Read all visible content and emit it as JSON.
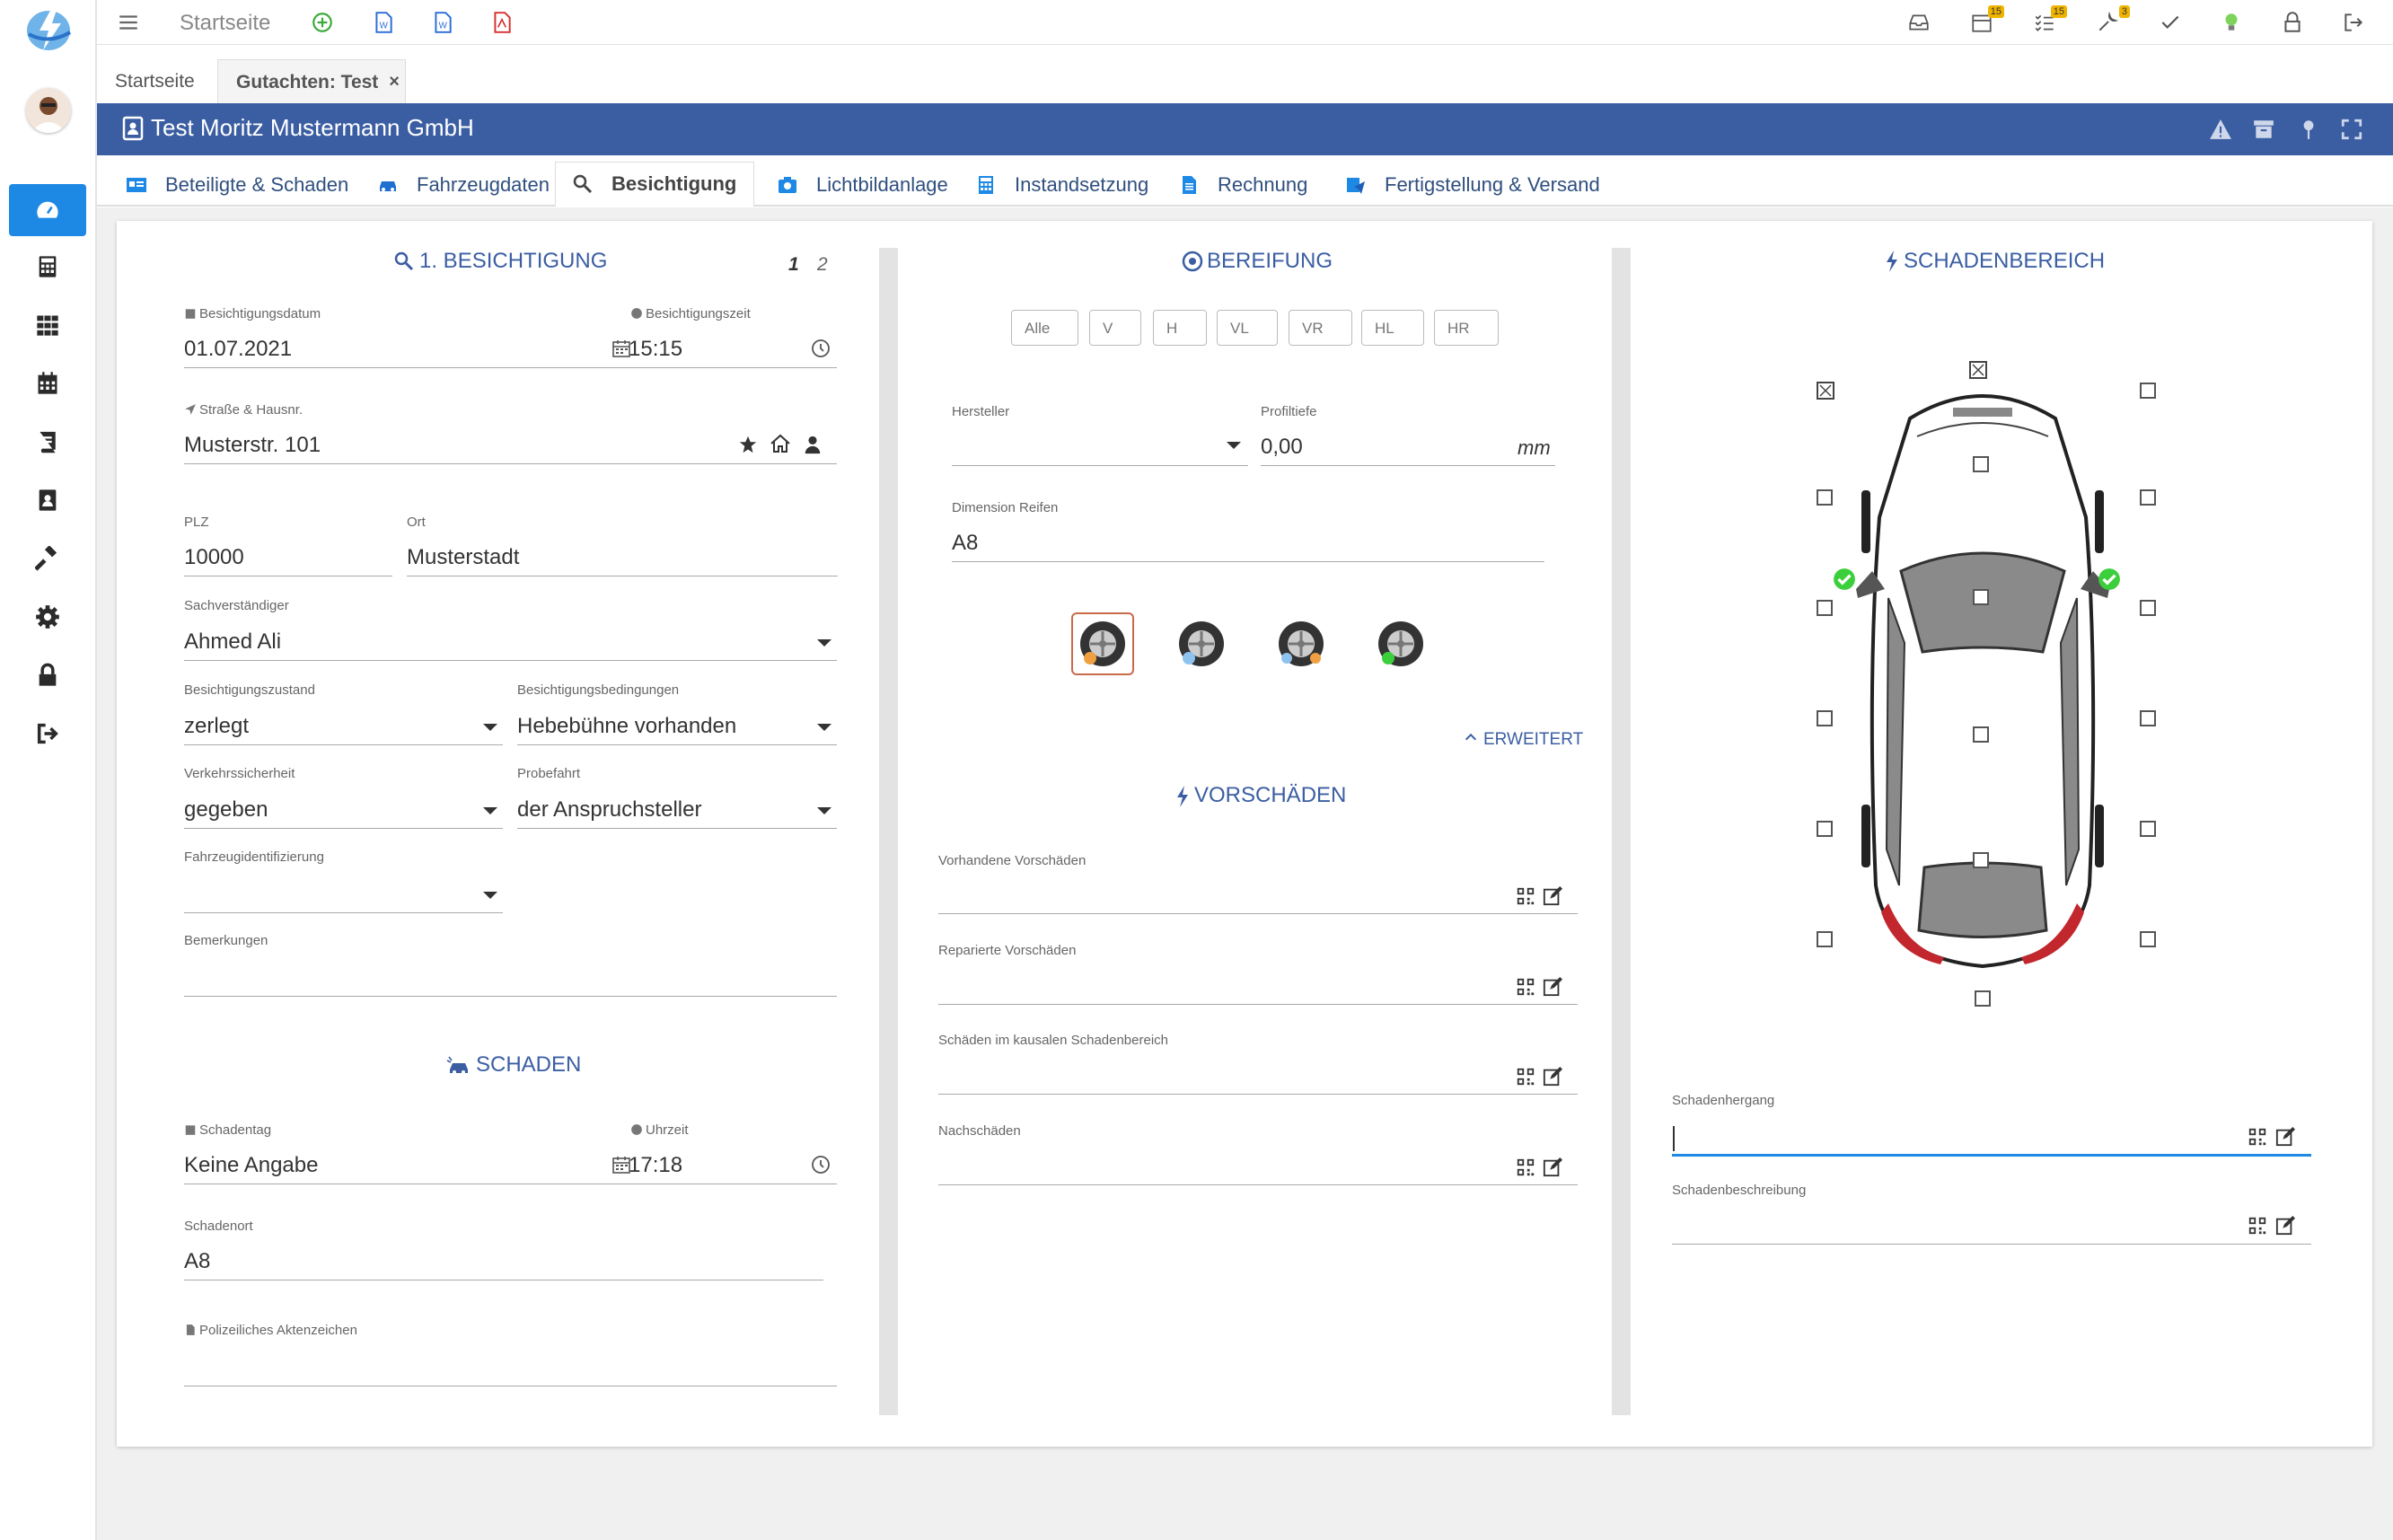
{
  "colors": {
    "primary": "#3b5ea3",
    "accent": "#1e88e5",
    "badge": "#f0b400",
    "check": "#3ccf3c"
  },
  "topbar": {
    "title": "Startseite",
    "badges": {
      "calendar": "15",
      "tasks": "15",
      "tools": "3"
    }
  },
  "page_tabs": [
    {
      "label": "Startseite"
    },
    {
      "label": "Gutachten: Test",
      "close": "×"
    }
  ],
  "header": {
    "title": "Test Moritz Mustermann GmbH"
  },
  "subtabs": [
    {
      "label": "Beteiligte & Schaden",
      "icon": "id-card-icon"
    },
    {
      "label": "Fahrzeugdaten",
      "icon": "car-icon"
    },
    {
      "label": "Besichtigung",
      "icon": "search-icon"
    },
    {
      "label": "Lichtbildanlage",
      "icon": "camera-icon"
    },
    {
      "label": "Instandsetzung",
      "icon": "calculator-icon"
    },
    {
      "label": "Rechnung",
      "icon": "document-icon"
    },
    {
      "label": "Fertigstellung & Versand",
      "icon": "send-icon"
    }
  ],
  "besichtigung": {
    "title": "1. BESICHTIGUNG",
    "pages": [
      "1",
      "2"
    ],
    "datum_label": "Besichtigungsdatum",
    "datum": "01.07.2021",
    "zeit_label": "Besichtigungszeit",
    "zeit": "15:15",
    "strasse_label": "Straße & Hausnr.",
    "strasse": "Musterstr. 101",
    "plz_label": "PLZ",
    "plz": "10000",
    "ort_label": "Ort",
    "ort": "Musterstadt",
    "sv_label": "Sachverständiger",
    "sv": "Ahmed Ali",
    "zustand_label": "Besichtigungszustand",
    "zustand": "zerlegt",
    "bedingungen_label": "Besichtigungsbedingungen",
    "bedingungen": "Hebebühne vorhanden",
    "verkehr_label": "Verkehrssicherheit",
    "verkehr": "gegeben",
    "probefahrt_label": "Probefahrt",
    "probefahrt": "der Anspruchsteller",
    "ident_label": "Fahrzeugidentifizierung",
    "bemerk_label": "Bemerkungen"
  },
  "schaden": {
    "title": "SCHADEN",
    "tag_label": "Schadentag",
    "tag": "Keine Angabe",
    "uhrzeit_label": "Uhrzeit",
    "uhrzeit": "17:18",
    "ort_label": "Schadenort",
    "ort": "A8",
    "az_label": "Polizeiliches Aktenzeichen"
  },
  "bereifung": {
    "title": "BEREIFUNG",
    "buttons": [
      "Alle",
      "V",
      "H",
      "VL",
      "VR",
      "HL",
      "HR"
    ],
    "hersteller_label": "Hersteller",
    "profil_label": "Profiltiefe",
    "profil": "0,00",
    "unit": "mm",
    "dim_label": "Dimension Reifen",
    "dim": "A8",
    "erweitert": "ERWEITERT"
  },
  "vorschaeden": {
    "title": "VORSCHÄDEN",
    "fields": [
      "Vorhandene Vorschäden",
      "Reparierte Vorschäden",
      "Schäden im kausalen Schadenbereich",
      "Nachschäden"
    ]
  },
  "schadenbereich": {
    "title": "SCHADENBEREICH",
    "hergang_label": "Schadenhergang",
    "beschreibung_label": "Schadenbeschreibung"
  }
}
